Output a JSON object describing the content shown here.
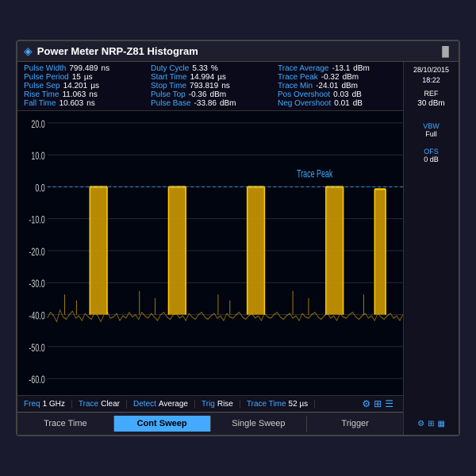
{
  "title": "Power Meter NRP-Z81 Histogram",
  "stats": [
    [
      {
        "label": "Pulse Width",
        "value": "799.489",
        "unit": "ns"
      },
      {
        "label": "Pulse Period",
        "value": "15",
        "unit": "µs"
      },
      {
        "label": "Pulse Sep",
        "value": "14.201",
        "unit": "µs"
      },
      {
        "label": "Rise Time",
        "value": "11.063",
        "unit": "ns"
      },
      {
        "label": "Fall Time",
        "value": "10.603",
        "unit": "ns"
      }
    ],
    [
      {
        "label": "Duty Cycle",
        "value": "5.33",
        "unit": "%"
      },
      {
        "label": "Start Time",
        "value": "14.994",
        "unit": "µs"
      },
      {
        "label": "Stop Time",
        "value": "793.819",
        "unit": "ns"
      },
      {
        "label": "Pulse Top",
        "value": "-0.36",
        "unit": "dBm"
      },
      {
        "label": "Pulse Base",
        "value": "-33.86",
        "unit": "dBm"
      }
    ],
    [
      {
        "label": "Trace Average",
        "value": "-13.1",
        "unit": "dBm"
      },
      {
        "label": "Trace Peak",
        "value": "-0.32",
        "unit": "dBm"
      },
      {
        "label": "Trace Min",
        "value": "-24.01",
        "unit": "dBm"
      },
      {
        "label": "Pos Overshoot",
        "value": "0.03",
        "unit": "dB"
      },
      {
        "label": "Neg Overshoot",
        "value": "0.01",
        "unit": "dB"
      }
    ]
  ],
  "yAxis": [
    "20.0",
    "10.0",
    "0.0",
    "-10.0",
    "-20.0",
    "-30.0",
    "-40.0",
    "-50.0",
    "-60.0"
  ],
  "tracePeakLabel": "Trace Peak",
  "statusBar": [
    {
      "label": "Freq",
      "value": "1 GHz"
    },
    {
      "label": "Trace",
      "value": "Clear"
    },
    {
      "label": "Detect",
      "value": "Average"
    },
    {
      "label": "Trig",
      "value": "Rise"
    },
    {
      "label": "Trace Time",
      "value": "52 µs"
    }
  ],
  "toolbar": [
    {
      "label": "Trace Time",
      "active": false
    },
    {
      "label": "Cont Sweep",
      "active": true
    },
    {
      "label": "Single Sweep",
      "active": false
    },
    {
      "label": "Trigger",
      "active": false
    }
  ],
  "rightPanel": {
    "date": "28/10/2015",
    "time": "18:22",
    "ref_label": "REF",
    "ref_value": "30 dBm",
    "vbw_label": "VBW",
    "vbw_value": "Full",
    "ofs_label": "OFS",
    "ofs_value": "0 dB"
  }
}
